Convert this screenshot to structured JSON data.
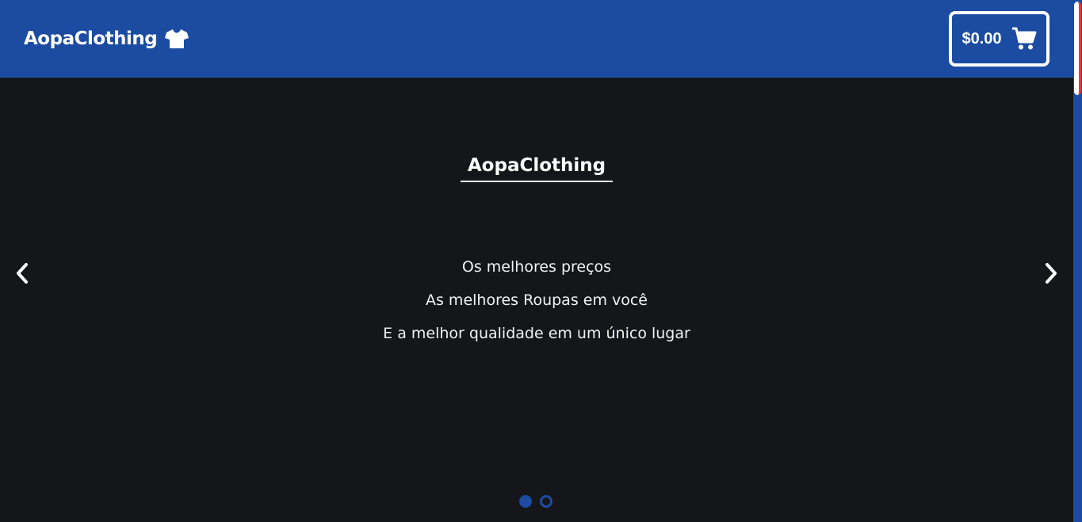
{
  "navbar": {
    "brand": "AopaClothing",
    "brand_icon": "tshirt-icon",
    "cart_total": "$0.00",
    "cart_icon": "shopping-cart-icon"
  },
  "hero": {
    "title": "AopaClothing",
    "lines": [
      "Os melhores preços",
      "As melhores Roupas em você",
      "E a melhor qualidade em um único lugar"
    ]
  },
  "carousel": {
    "prev_icon": "chevron-left-icon",
    "next_icon": "chevron-right-icon",
    "slide_count": 2,
    "active_slide": 1
  },
  "colors": {
    "primary": "#1c4ca1",
    "background": "#15161a",
    "text": "#ffffff"
  }
}
